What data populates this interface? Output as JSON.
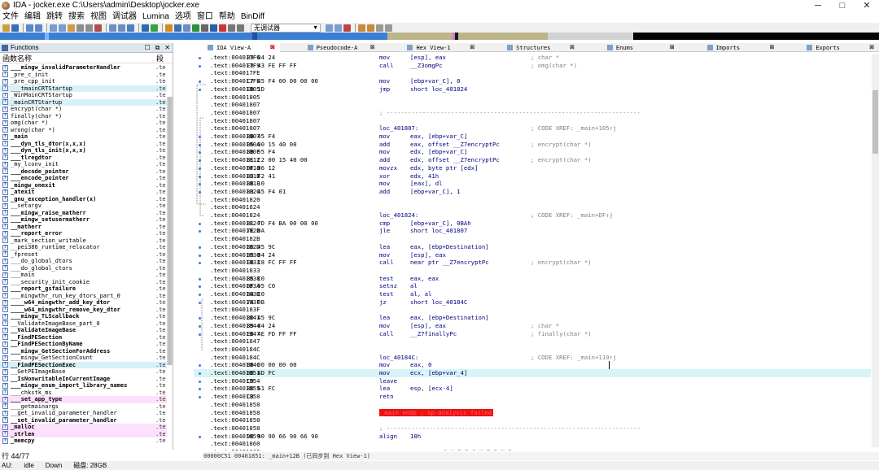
{
  "window": {
    "title": "IDA - jocker.exe C:\\Users\\admin\\Desktop\\jocker.exe",
    "minimize": "─",
    "maximize": "□",
    "close": "✕"
  },
  "menu": [
    "文件",
    "编辑",
    "跳转",
    "搜索",
    "视图",
    "调试器",
    "Lumina",
    "选项",
    "窗口",
    "帮助",
    "BinDiff"
  ],
  "toolbar": {
    "debugger_combo": "无调试器"
  },
  "functions_pane": {
    "title": "Functions",
    "col_name": "函数名称",
    "col_seg": "段",
    "row_count": "行 44/77",
    "items": [
      {
        "name": "___mingw_invalidParameterHandler",
        "seg": ".te",
        "bold": true
      },
      {
        "name": "_pre_c_init",
        "seg": ".te",
        "bold": false
      },
      {
        "name": "_pre_cpp_init",
        "seg": ".te",
        "bold": false
      },
      {
        "name": "___tmainCRTStartup",
        "seg": ".te",
        "bold": false
      },
      {
        "name": "_WinMainCRTStartup",
        "seg": ".te",
        "bold": false
      },
      {
        "name": "_mainCRTStartup",
        "seg": ".te",
        "bold": false
      },
      {
        "name": "encrypt(char *)",
        "seg": ".te",
        "bold": false
      },
      {
        "name": "finally(char *)",
        "seg": ".te",
        "bold": false
      },
      {
        "name": "omg(char *)",
        "seg": ".te",
        "bold": false
      },
      {
        "name": "wrong(char *)",
        "seg": ".te",
        "bold": false
      },
      {
        "name": "_main",
        "seg": ".te",
        "bold": true
      },
      {
        "name": "___dyn_tls_dtor(x,x,x)",
        "seg": ".te",
        "bold": true
      },
      {
        "name": "___dyn_tls_init(x,x,x)",
        "seg": ".te",
        "bold": true
      },
      {
        "name": "___tlregdtor",
        "seg": ".te",
        "bold": true
      },
      {
        "name": "_my_lconv_init",
        "seg": ".te",
        "bold": false
      },
      {
        "name": "___decode_pointer",
        "seg": ".te",
        "bold": true
      },
      {
        "name": "___encode_pointer",
        "seg": ".te",
        "bold": true
      },
      {
        "name": "_mingw_onexit",
        "seg": ".te",
        "bold": true
      },
      {
        "name": "_atexit",
        "seg": ".te",
        "bold": true
      },
      {
        "name": "_gnu_exception_handler(x)",
        "seg": ".te",
        "bold": true
      },
      {
        "name": "__setargv",
        "seg": ".te",
        "bold": false
      },
      {
        "name": "___mingw_raise_matherr",
        "seg": ".te",
        "bold": true
      },
      {
        "name": "___mingw_setusermatherr",
        "seg": ".te",
        "bold": true
      },
      {
        "name": "__matherr",
        "seg": ".te",
        "bold": true
      },
      {
        "name": "___report_error",
        "seg": ".te",
        "bold": true
      },
      {
        "name": "_mark_section_writable",
        "seg": ".te",
        "bold": false
      },
      {
        "name": "__pei386_runtime_relocator",
        "seg": ".te",
        "bold": false
      },
      {
        "name": "_fpreset",
        "seg": ".te",
        "bold": false
      },
      {
        "name": "___do_global_dtors",
        "seg": ".te",
        "bold": false
      },
      {
        "name": "___do_global_ctors",
        "seg": ".te",
        "bold": false
      },
      {
        "name": "___main",
        "seg": ".te",
        "bold": false
      },
      {
        "name": "___security_init_cookie",
        "seg": ".te",
        "bold": false
      },
      {
        "name": "___report_gsfailure",
        "seg": ".te",
        "bold": true
      },
      {
        "name": "___mingwthr_run_key_dtors_part_0",
        "seg": ".te",
        "bold": false
      },
      {
        "name": "____w64_mingwthr_add_key_dtor",
        "seg": ".te",
        "bold": true
      },
      {
        "name": "____w64_mingwthr_remove_key_dtor",
        "seg": ".te",
        "bold": true
      },
      {
        "name": "___mingw_TLScallback",
        "seg": ".te",
        "bold": true
      },
      {
        "name": "__ValidateImageBase_part_0",
        "seg": ".te",
        "bold": false
      },
      {
        "name": "__ValidateImageBase",
        "seg": ".te",
        "bold": true
      },
      {
        "name": "__FindPESection",
        "seg": ".te",
        "bold": true
      },
      {
        "name": "__FindPESectionByName",
        "seg": ".te",
        "bold": true
      },
      {
        "name": "___mingw_GetSectionForAddress",
        "seg": ".te",
        "bold": true
      },
      {
        "name": "___mingw_GetSectionCount",
        "seg": ".te",
        "bold": false
      },
      {
        "name": "__FindPESectionExec",
        "seg": ".te",
        "bold": true
      },
      {
        "name": "__GetPEImageBase",
        "seg": ".te",
        "bold": false
      },
      {
        "name": "__IsNonwritableInCurrentImage",
        "seg": ".te",
        "bold": true
      },
      {
        "name": "___mingw_enum_import_library_names",
        "seg": ".te",
        "bold": true
      },
      {
        "name": "___chkstk_ms",
        "seg": ".te",
        "bold": false
      },
      {
        "name": "___set_app_type",
        "seg": ".te",
        "bold": true
      },
      {
        "name": "___getmainargs",
        "seg": ".te",
        "bold": false
      },
      {
        "name": "__get_invalid_parameter_handler",
        "seg": ".te",
        "bold": false
      },
      {
        "name": "__set_invalid_parameter_handler",
        "seg": ".te",
        "bold": true
      },
      {
        "name": "_malloc",
        "seg": ".te",
        "bold": true
      },
      {
        "name": "_strlen",
        "seg": ".te",
        "bold": true
      },
      {
        "name": "_memcpy",
        "seg": ".te",
        "bold": true
      }
    ]
  },
  "tabs": [
    {
      "label": "IDA View-A",
      "close": "⊠",
      "active": true,
      "red": true
    },
    {
      "label": "Pseudocode-A",
      "close": "⊠",
      "active": false,
      "red": false
    },
    {
      "label": "Hex View-1",
      "close": "⊠",
      "active": false,
      "red": false
    },
    {
      "label": "Structures",
      "close": "⊠",
      "active": false,
      "red": false
    },
    {
      "label": "Enums",
      "close": "⊠",
      "active": false,
      "red": false
    },
    {
      "label": "Imports",
      "close": "⊠",
      "active": false,
      "red": false
    },
    {
      "label": "Exports",
      "close": "⊠",
      "active": false,
      "red": false
    }
  ],
  "listing": [
    {
      "addr": ".text:004017F6",
      "bytes": "89 04 24",
      "mnem": "mov",
      "ops": "[esp], eax",
      "cmt": "; char *"
    },
    {
      "addr": ".text:004017F9",
      "bytes": "E8 43 FE FF FF",
      "mnem": "call",
      "ops": "__Z3omgPc",
      "cmt": "; omg(char *)"
    },
    {
      "addr": ".text:004017FE",
      "bytes": "",
      "mnem": "",
      "ops": "",
      "cmt": ""
    },
    {
      "addr": ".text:004017FE",
      "bytes": "C7 45 F4 00 00 00 00",
      "mnem": "mov",
      "ops": "[ebp+var_C], 0",
      "cmt": ""
    },
    {
      "addr": ".text:00401805",
      "bytes": "EB 1D",
      "mnem": "jmp",
      "ops": "short loc_401824",
      "cmt": ""
    },
    {
      "addr": ".text:00401805",
      "bytes": "",
      "mnem": "",
      "ops": "",
      "cmt": ""
    },
    {
      "addr": ".text:00401807",
      "bytes": "",
      "mnem": "",
      "ops": "",
      "cmt": ""
    },
    {
      "addr": ".text:00401807",
      "bytes": "",
      "mnem": "",
      "ops": "",
      "cmt": "",
      "dash": "; -----------------------------------------------------------------------"
    },
    {
      "addr": ".text:00401807",
      "bytes": "",
      "mnem": "",
      "ops": "",
      "cmt": ""
    },
    {
      "addr": ".text:00401807",
      "bytes": "",
      "mnem": "",
      "ops": "",
      "cmt": "; CODE XREF: _main+105↑j",
      "label": "loc_401807:"
    },
    {
      "addr": ".text:00401807",
      "bytes": "8B 45 F4",
      "mnem": "mov",
      "ops": "eax, [ebp+var_C]",
      "cmt": ""
    },
    {
      "addr": ".text:0040180A",
      "bytes": "05 00 15 40 00",
      "mnem": "add",
      "ops": "eax, offset __Z7encryptPc",
      "cmt": "; encrypt(char *)"
    },
    {
      "addr": ".text:0040180F",
      "bytes": "8B 55 F4",
      "mnem": "mov",
      "ops": "edx, [ebp+var_C]",
      "cmt": ""
    },
    {
      "addr": ".text:00401812",
      "bytes": "81 C2 00 15 40 00",
      "mnem": "add",
      "ops": "edx, offset __Z7encryptPc",
      "cmt": "; encrypt(char *)"
    },
    {
      "addr": ".text:00401818",
      "bytes": "0F B6 12",
      "mnem": "movzx",
      "ops": "edx, byte ptr [edx]",
      "cmt": ""
    },
    {
      "addr": ".text:0040181B",
      "bytes": "83 F2 41",
      "mnem": "xor",
      "ops": "edx, 41h",
      "cmt": ""
    },
    {
      "addr": ".text:0040181E",
      "bytes": "88 10",
      "mnem": "mov",
      "ops": "[eax], dl",
      "cmt": ""
    },
    {
      "addr": ".text:00401820",
      "bytes": "83 45 F4 01",
      "mnem": "add",
      "ops": "[ebp+var_C], 1",
      "cmt": ""
    },
    {
      "addr": ".text:00401820",
      "bytes": "",
      "mnem": "",
      "ops": "",
      "cmt": ""
    },
    {
      "addr": ".text:00401824",
      "bytes": "",
      "mnem": "",
      "ops": "",
      "cmt": ""
    },
    {
      "addr": ".text:00401824",
      "bytes": "",
      "mnem": "",
      "ops": "",
      "cmt": "; CODE XREF: _main+DF↑j",
      "label": "loc_401824:"
    },
    {
      "addr": ".text:00401824",
      "bytes": "81 7D F4 BA 00 00 00",
      "mnem": "cmp",
      "ops": "[ebp+var_C], 0BAh",
      "cmt": ""
    },
    {
      "addr": ".text:0040182B",
      "bytes": "7E DA",
      "mnem": "jle",
      "ops": "short loc_401807",
      "cmt": ""
    },
    {
      "addr": ".text:0040182B",
      "bytes": "",
      "mnem": "",
      "ops": "",
      "cmt": ""
    },
    {
      "addr": ".text:0040182D",
      "bytes": "8D 45 9C",
      "mnem": "lea",
      "ops": "eax, [ebp+Destination]",
      "cmt": ""
    },
    {
      "addr": ".text:00401830",
      "bytes": "89 04 24",
      "mnem": "mov",
      "ops": "[esp], eax",
      "cmt": ""
    },
    {
      "addr": ".text:00401833",
      "bytes": "E8 C8 FC FF FF",
      "mnem": "call",
      "ops": "near ptr __Z7encryptPc",
      "cmt": "; encrypt(char *)"
    },
    {
      "addr": ".text:00401833",
      "bytes": "",
      "mnem": "",
      "ops": "",
      "cmt": ""
    },
    {
      "addr": ".text:00401838",
      "bytes": "85 C0",
      "mnem": "test",
      "ops": "eax, eax",
      "cmt": ""
    },
    {
      "addr": ".text:0040183A",
      "bytes": "0F 95 C0",
      "mnem": "setnz",
      "ops": "al",
      "cmt": ""
    },
    {
      "addr": ".text:0040183D",
      "bytes": "84 C0",
      "mnem": "test",
      "ops": "al, al",
      "cmt": ""
    },
    {
      "addr": ".text:0040183F",
      "bytes": "74 0B",
      "mnem": "jz",
      "ops": "short loc_40184C",
      "cmt": ""
    },
    {
      "addr": ".text:0040183F",
      "bytes": "",
      "mnem": "",
      "ops": "",
      "cmt": ""
    },
    {
      "addr": ".text:00401841",
      "bytes": "8D 45 9C",
      "mnem": "lea",
      "ops": "eax, [ebp+Destination]",
      "cmt": ""
    },
    {
      "addr": ".text:00401844",
      "bytes": "89 04 24",
      "mnem": "mov",
      "ops": "[esp], eax",
      "cmt": "; char *"
    },
    {
      "addr": ".text:00401847",
      "bytes": "E8 4E FD FF FF",
      "mnem": "call",
      "ops": "__Z7finallyPc",
      "cmt": "; finally(char *)"
    },
    {
      "addr": ".text:00401847",
      "bytes": "",
      "mnem": "",
      "ops": "",
      "cmt": ""
    },
    {
      "addr": ".text:0040184C",
      "bytes": "",
      "mnem": "",
      "ops": "",
      "cmt": ""
    },
    {
      "addr": ".text:0040184C",
      "bytes": "",
      "mnem": "",
      "ops": "",
      "cmt": "; CODE XREF: _main+119↑j",
      "label": "loc_40184C:"
    },
    {
      "addr": ".text:0040184C",
      "bytes": "B8 00 00 00 00",
      "mnem": "mov",
      "ops": "eax, 0",
      "cmt": ""
    },
    {
      "addr": ".text:00401851",
      "bytes": "8B 4D FC",
      "mnem": "mov",
      "ops": "ecx, [ebp+var_4]",
      "cmt": "",
      "hl": true
    },
    {
      "addr": ".text:00401854",
      "bytes": "C9",
      "mnem": "leave",
      "ops": "",
      "cmt": ""
    },
    {
      "addr": ".text:00401855",
      "bytes": "8D 61 FC",
      "mnem": "lea",
      "ops": "esp, [ecx-4]",
      "cmt": ""
    },
    {
      "addr": ".text:00401858",
      "bytes": "C3",
      "mnem": "retn",
      "ops": "",
      "cmt": ""
    },
    {
      "addr": ".text:00401858",
      "bytes": "",
      "mnem": "",
      "ops": "",
      "cmt": ""
    },
    {
      "addr": ".text:00401858",
      "bytes": "",
      "mnem": "",
      "ops": "",
      "cmt": "",
      "err": "_main endp ; sp-analysis failed"
    },
    {
      "addr": ".text:00401858",
      "bytes": "",
      "mnem": "",
      "ops": "",
      "cmt": ""
    },
    {
      "addr": ".text:00401858",
      "bytes": "",
      "mnem": "",
      "ops": "",
      "cmt": "",
      "dash": "; -----------------------------------------------------------------------"
    },
    {
      "addr": ".text:00401859",
      "bytes": "90 90 90 66 90 66 90",
      "mnem": "align",
      "ops": "10h",
      "cmt": ""
    },
    {
      "addr": ".text:00401860",
      "bytes": "",
      "mnem": "",
      "ops": "",
      "cmt": ""
    },
    {
      "addr": ".text:00401860",
      "bytes": "",
      "mnem": "",
      "ops": "",
      "cmt": "",
      "dash": "; =============== S U B R O U T I N E ======================================="
    }
  ],
  "status": {
    "position": "00000C51 00401851: _main+12B (已同步到 Hex View-1)",
    "au": "AU:",
    "au_state": "idle",
    "direction": "Down",
    "disk": "磁盘: 28GB"
  }
}
